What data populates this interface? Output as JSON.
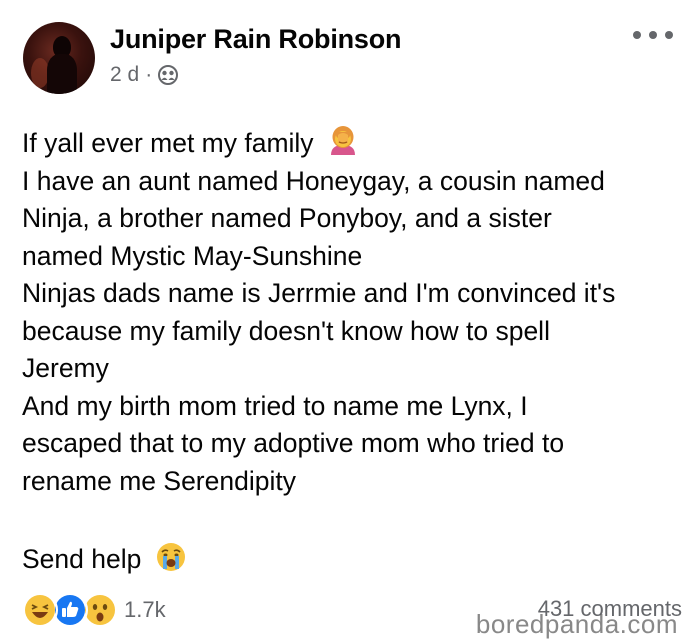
{
  "post": {
    "author": "Juniper Rain Robinson",
    "time": "2 d",
    "separator": "·",
    "audience_icon": "friends-icon",
    "more_icon": "more-options-icon",
    "lines": [
      "If yall ever met my family",
      "I have an aunt named Honeygay, a cousin named",
      "Ninja, a brother named Ponyboy, and a sister",
      "named Mystic May-Sunshine",
      "Ninjas dads name is Jerrmie and I'm convinced it's",
      "because my family doesn't know how to spell",
      "Jeremy",
      "And my birth mom tried to name me Lynx, I",
      "escaped that to my adoptive mom who tried to",
      "rename me Serendipity",
      "Send help"
    ],
    "emoji_facepalm": "woman-facepalming-emoji",
    "emoji_crying": "crying-face-emoji"
  },
  "footer": {
    "reactions": [
      "haha-reaction-icon",
      "like-reaction-icon",
      "wow-reaction-icon"
    ],
    "reaction_count": "1.7k",
    "comments": "431 comments"
  },
  "watermark": "boredpanda.com",
  "colors": {
    "text": "#050505",
    "secondary": "#65676b",
    "like_blue": "#1877f2",
    "emoji_yellow": "#f7c43f"
  }
}
